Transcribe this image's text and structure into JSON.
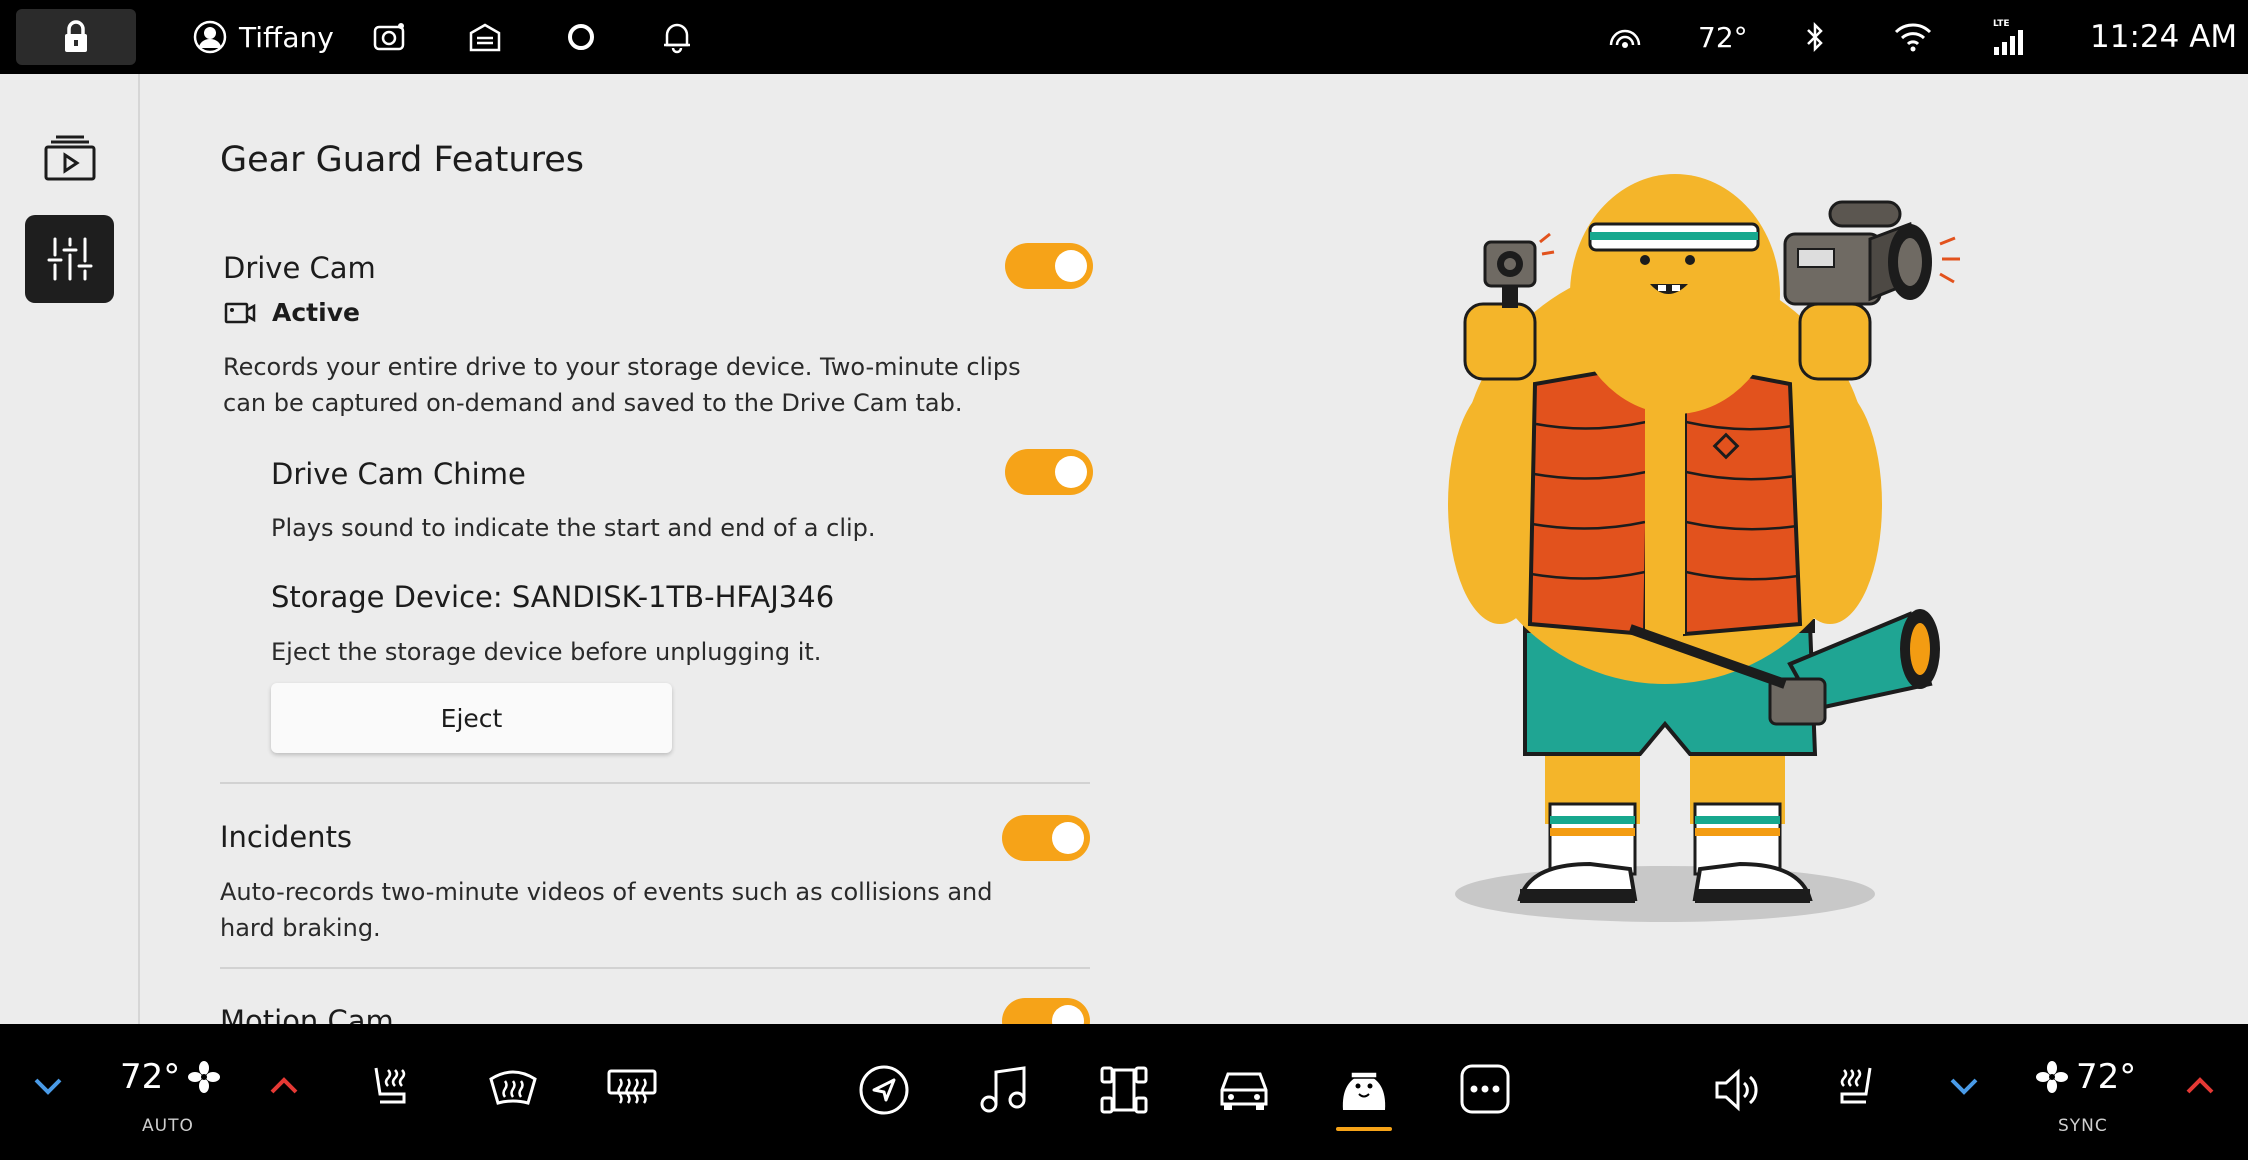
{
  "status_bar": {
    "profile_name": "Tiffany",
    "temperature": "72°",
    "time": "11:24 AM",
    "lte_label": "LTE",
    "icons": [
      "lock-icon",
      "user-icon",
      "camera-icon",
      "garage-icon",
      "ring-icon",
      "bell-icon",
      "gear-guard-icon",
      "bluetooth-icon",
      "wifi-icon",
      "cellular-icon"
    ]
  },
  "sidebar": {
    "items": [
      {
        "name": "clips",
        "icon": "video-library-icon",
        "active": false
      },
      {
        "name": "settings",
        "icon": "sliders-icon",
        "active": true
      }
    ]
  },
  "main": {
    "title": "Gear Guard Features",
    "drive_cam": {
      "title": "Drive Cam",
      "enabled": true,
      "status": "Active",
      "description_line1": "Records your entire drive to your storage device. Two-minute clips",
      "description_line2": "can be captured on-demand and saved to the Drive Cam tab."
    },
    "chime": {
      "title": "Drive Cam Chime",
      "enabled": true,
      "description": "Plays sound to indicate the start and end of a clip."
    },
    "storage": {
      "title": "Storage Device: SANDISK-1TB-HFAJ346",
      "description": "Eject the storage device before unplugging it.",
      "eject_label": "Eject"
    },
    "incidents": {
      "title": "Incidents",
      "enabled": true,
      "description_line1": "Auto-records two-minute videos of events such as collisions and",
      "description_line2": "hard braking."
    },
    "motion_cam": {
      "title": "Motion Cam",
      "enabled": true
    }
  },
  "bottom_bar": {
    "driver_temp": "72°",
    "driver_mode": "AUTO",
    "passenger_temp": "72°",
    "passenger_mode": "SYNC",
    "active_app": "gear-guard",
    "colors": {
      "accent": "#f6a318",
      "down_arrow": "#4a9be8",
      "up_arrow": "#e53935"
    }
  }
}
